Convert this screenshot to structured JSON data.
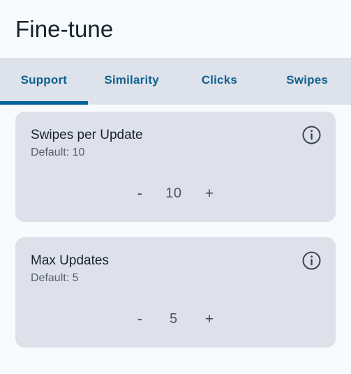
{
  "header": {
    "title": "Fine-tune"
  },
  "tabs": {
    "active_index": 0,
    "items": [
      {
        "label": "Support"
      },
      {
        "label": "Similarity"
      },
      {
        "label": "Clicks"
      },
      {
        "label": "Swipes"
      }
    ]
  },
  "colors": {
    "page_background": "#f7fbfd",
    "tabbar_background": "#dee2ea",
    "tab_text": "#10628f",
    "tab_active_underline": "#00619b",
    "card_background": "#dee1e9",
    "card_title_text": "#16232b",
    "card_subtitle_text": "#56606a",
    "stepper_text": "#394450"
  },
  "cards": [
    {
      "title": "Swipes per Update",
      "default_label": "Default: 10",
      "info_icon": "info-circle-icon",
      "stepper": {
        "decrement_label": "-",
        "value": "10",
        "increment_label": "+"
      }
    },
    {
      "title": "Max Updates",
      "default_label": "Default: 5",
      "info_icon": "info-circle-icon",
      "stepper": {
        "decrement_label": "-",
        "value": "5",
        "increment_label": "+"
      }
    }
  ]
}
